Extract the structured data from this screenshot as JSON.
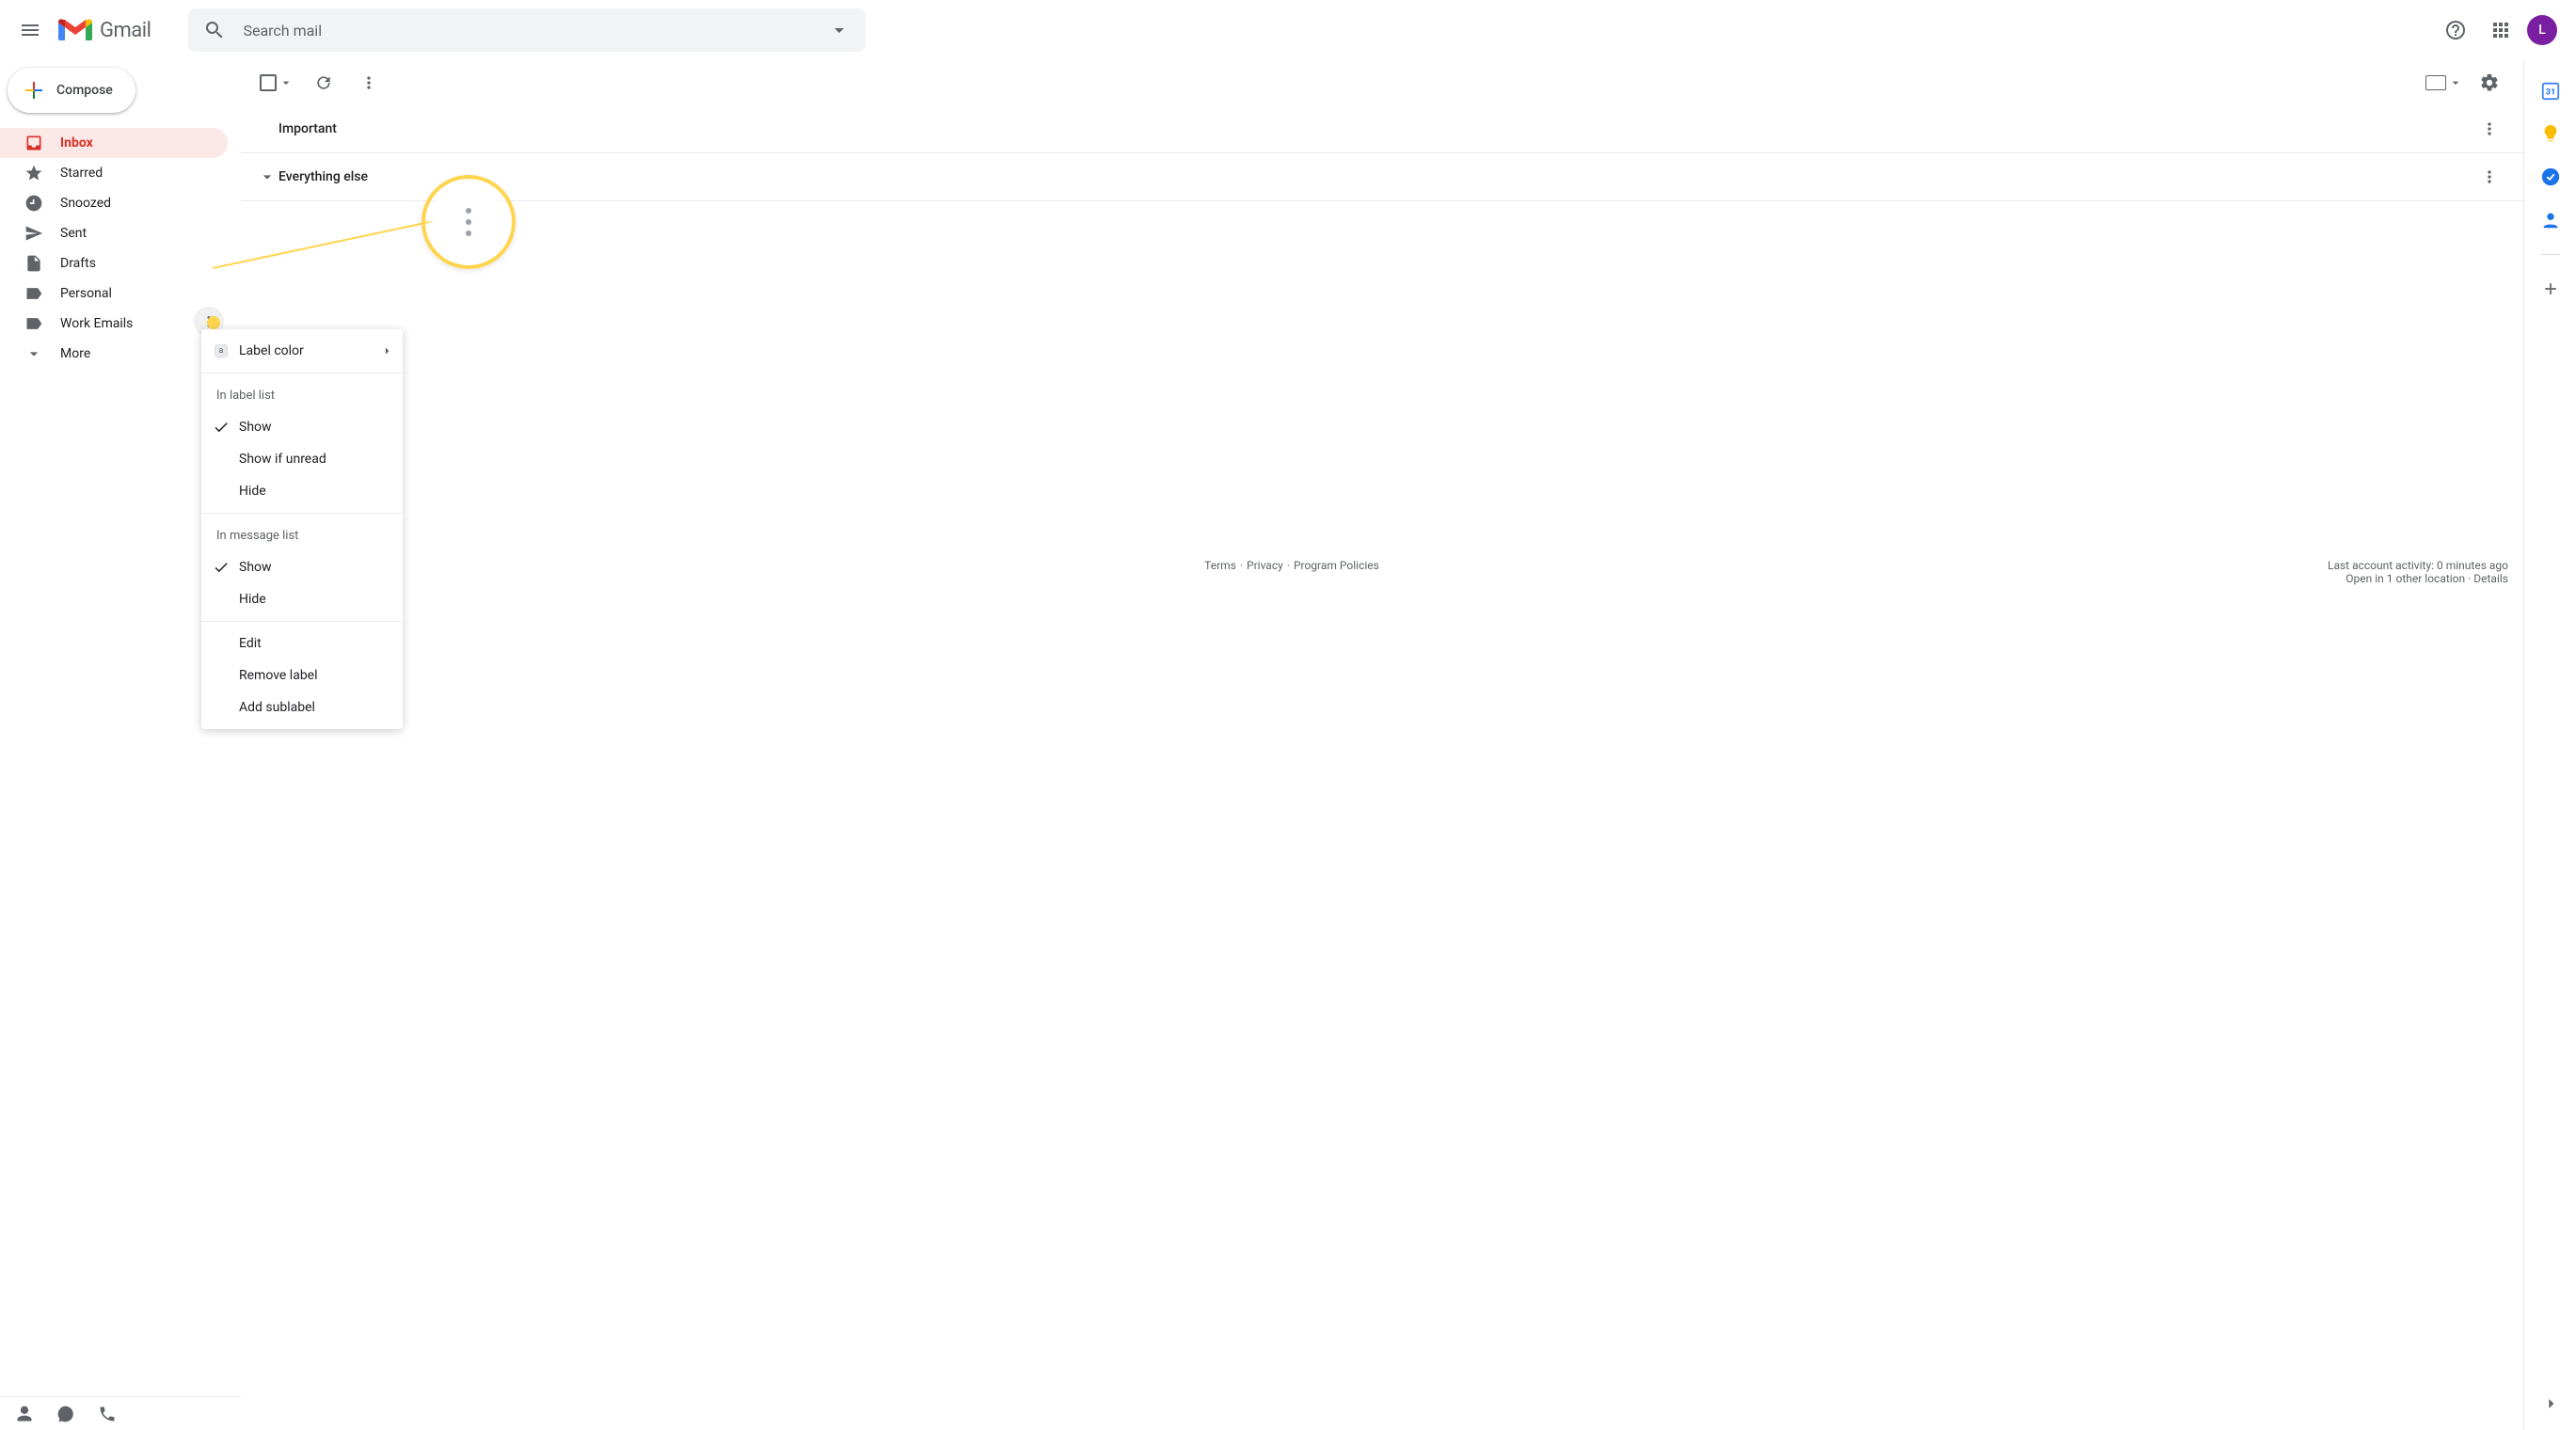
{
  "app": {
    "logo_text": "Gmail"
  },
  "search": {
    "placeholder": "Search mail"
  },
  "avatar": {
    "initial": "L"
  },
  "compose": {
    "label": "Compose"
  },
  "sidebar": {
    "items": [
      {
        "label": "Inbox",
        "icon": "inbox",
        "active": true
      },
      {
        "label": "Starred",
        "icon": "star",
        "active": false
      },
      {
        "label": "Snoozed",
        "icon": "clock",
        "active": false
      },
      {
        "label": "Sent",
        "icon": "send",
        "active": false
      },
      {
        "label": "Drafts",
        "icon": "file",
        "active": false
      },
      {
        "label": "Personal",
        "icon": "label",
        "active": false
      },
      {
        "label": "Work Emails",
        "icon": "label",
        "active": false
      }
    ],
    "more_label": "More"
  },
  "sections": [
    {
      "title": "Important",
      "collapsed": false,
      "has_caret": false
    },
    {
      "title": "Everything else",
      "collapsed": false,
      "has_caret": true
    }
  ],
  "context_menu": {
    "label_color": "Label color",
    "label_swatch_text": "a",
    "group1_header": "In label list",
    "group1_items": [
      {
        "label": "Show",
        "checked": true
      },
      {
        "label": "Show if unread",
        "checked": false
      },
      {
        "label": "Hide",
        "checked": false
      }
    ],
    "group2_header": "In message list",
    "group2_items": [
      {
        "label": "Show",
        "checked": true
      },
      {
        "label": "Hide",
        "checked": false
      }
    ],
    "actions": [
      {
        "label": "Edit"
      },
      {
        "label": "Remove label"
      },
      {
        "label": "Add sublabel"
      }
    ]
  },
  "footer": {
    "terms": "Terms",
    "privacy": "Privacy",
    "policies": "Program Policies",
    "activity": "Last account activity: 0 minutes ago",
    "open_in": "Open in 1 other location",
    "details": "Details"
  },
  "side_panel_icons": [
    "calendar-icon",
    "keep-icon",
    "tasks-icon",
    "contacts-icon"
  ],
  "colors": {
    "accent_red": "#d93025",
    "accent_bg": "#fce8e6",
    "annotation_yellow": "#ffd54f"
  }
}
